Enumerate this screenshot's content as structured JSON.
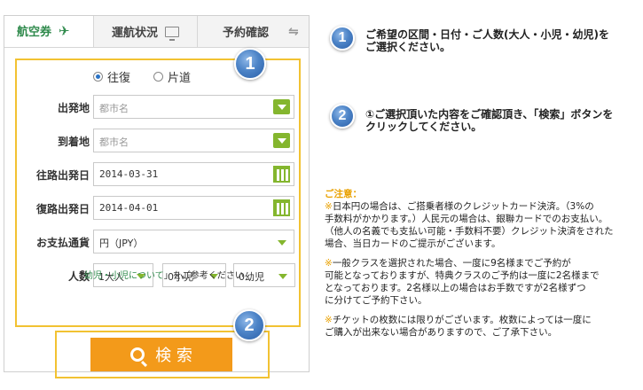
{
  "tabs": {
    "flight": "航空券",
    "status": "運航状況",
    "reserve": "予約確認"
  },
  "trip": {
    "round": "往復",
    "oneway": "片道"
  },
  "fields": {
    "departure_label": "出発地",
    "departure_placeholder": "都市名",
    "arrival_label": "到着地",
    "arrival_placeholder": "都市名",
    "outbound_label": "往路出発日",
    "outbound_value": "2014-03-31",
    "return_label": "復路出発日",
    "return_value": "2014-04-01",
    "currency_label": "お支払通貨",
    "currency_value": "円（JPY）",
    "pax_label": "人数",
    "adult": "1大人",
    "child": "0小児",
    "infant": "0幼児"
  },
  "note": {
    "open": "「",
    "link": "幼児・小児について",
    "rest": "」をご参考ください"
  },
  "search_label": "検 索",
  "badges": [
    "1",
    "2"
  ],
  "instructions": {
    "step1_line1": "ご希望の区間・日付・ご人数(大人・小児・幼児)を",
    "step1_line2": "ご選択ください。",
    "step2_line1": "①ご選択頂いた内容をご確認頂き、「検索」ボタンを",
    "step2_line2": "クリックしてください。"
  },
  "caution": {
    "title": "ご注意：",
    "p1_mark": "※",
    "p1_line1": "日本円の場合は、ご搭乗者様のクレジットカード決済。（3%の",
    "p1_line2": "手数料がかかります。）人民元の場合は、銀聯カードでのお支払い。",
    "p1_line3": "（他人の名義でも支払い可能・手数料不要）クレジット決済をされた",
    "p1_line4": "場合、当日カードのご提示がございます。",
    "p2_mark": "※",
    "p2_line1": "一般クラスを選択された場合、一度に9名様までご予約が",
    "p2_line2": "可能となっておりますが、特典クラスのご予約は一度に2名様まで",
    "p2_line3": "となっております。2名様以上の場合はお手数ですが2名様ずつ",
    "p2_line4": "に分けてご予約下さい。",
    "p3_mark": "※",
    "p3_line1": "チケットの枚数には限りがございます。枚数によっては一度に",
    "p3_line2": "ご購入が出来ない場合がありますので、ご了承下さい。"
  }
}
